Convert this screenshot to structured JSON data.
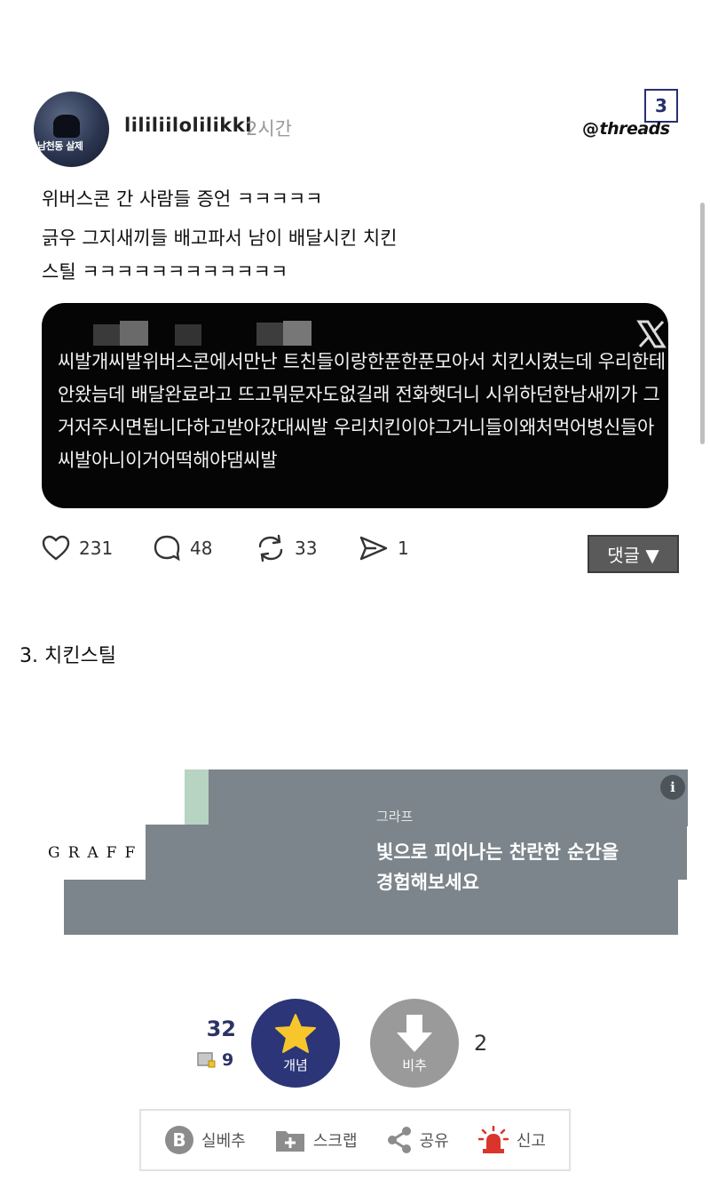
{
  "threads_post": {
    "username": "lililiilolilikkl",
    "time": "2시간",
    "avatar_caption": "남천동 살제",
    "badge_number": "3",
    "platform": "threads",
    "lines": [
      "위버스콘 간 사람들 증언 ㅋㅋㅋㅋㅋ",
      "긁우 그지새끼들 배고파서 남이 배달시킨 치킨",
      "스틸 ㅋㅋㅋㅋㅋㅋㅋㅋㅋㅋㅋㅋ"
    ],
    "tweet_text": "씨발개씨발위버스콘에서만난 트친들이랑한푼한푼모아서 치킨시켰는데 우리한테안왔늠데 배달완료라고 뜨고뭐문자도없길래 전화햇더니 시위하던한남새끼가 그거저주시면됩니다하고받아갔대씨발 우리치킨이야그거니들이왜처먹어병신들아씨발아니이거어떡해야댐씨발",
    "actions": {
      "likes": "231",
      "comments": "48",
      "reposts": "33",
      "shares": "1"
    },
    "comment_button": "댓글 ▼"
  },
  "section_title": "3. 치킨스틸",
  "ad": {
    "logo": "GRAFF",
    "brand": "그라프",
    "copy_line1": "빛으로 피어나는 찬란한 순간을",
    "copy_line2": "경험해보세요",
    "info": "i"
  },
  "votes": {
    "up_count": "32",
    "fixed_count": "9",
    "up_label": "개념",
    "down_label": "비추",
    "down_count": "2"
  },
  "bottom_bar": {
    "realbest": "실베추",
    "scrap": "스크랩",
    "share": "공유",
    "report": "신고"
  }
}
